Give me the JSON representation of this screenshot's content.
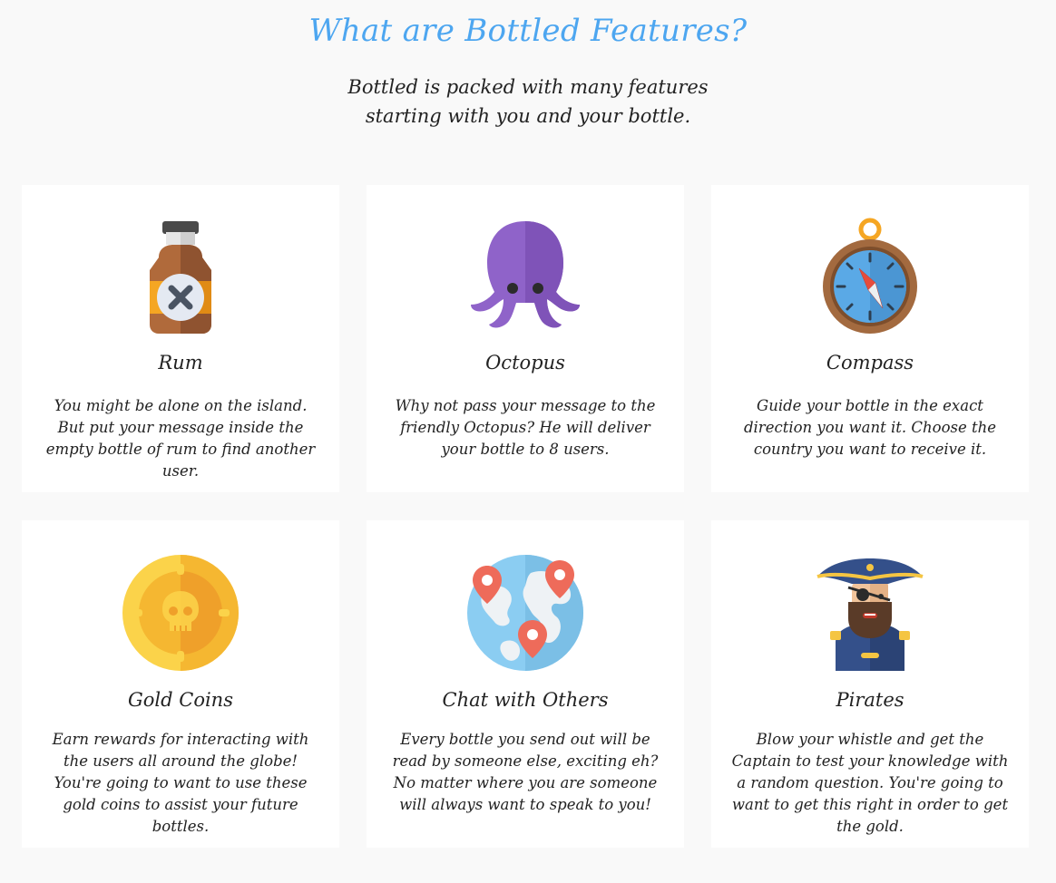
{
  "header": {
    "title": "What are Bottled Features?",
    "subtitle_line1": "Bottled is packed with many features",
    "subtitle_line2": "starting with you and your bottle."
  },
  "features": [
    {
      "name": "Rum",
      "icon": "rum-bottle-icon",
      "description": "You might be alone on the island. But put your message inside the empty bottle of rum to find another user."
    },
    {
      "name": "Octopus",
      "icon": "octopus-icon",
      "description": "Why not pass your message to the friendly Octopus? He will deliver your bottle to 8 users."
    },
    {
      "name": "Compass",
      "icon": "compass-icon",
      "description": "Guide your bottle in the exact direction you want it. Choose the country you want to receive it."
    },
    {
      "name": "Gold Coins",
      "icon": "gold-coin-icon",
      "description": "Earn rewards for interacting with the users all around the globe! You're going to want to use these gold coins to assist your future bottles."
    },
    {
      "name": "Chat with Others",
      "icon": "globe-pins-icon",
      "description": "Every bottle you send out will be read by someone else, exciting eh? No matter where you are someone will always want to speak to you!"
    },
    {
      "name": "Pirates",
      "icon": "pirate-captain-icon",
      "description": "Blow your whistle and get the Captain to test your knowledge with a random question. You're going to want to get this right in order to get the gold."
    }
  ],
  "colors": {
    "title": "#4da6f0",
    "background": "#f9f9f9",
    "card": "#ffffff"
  }
}
